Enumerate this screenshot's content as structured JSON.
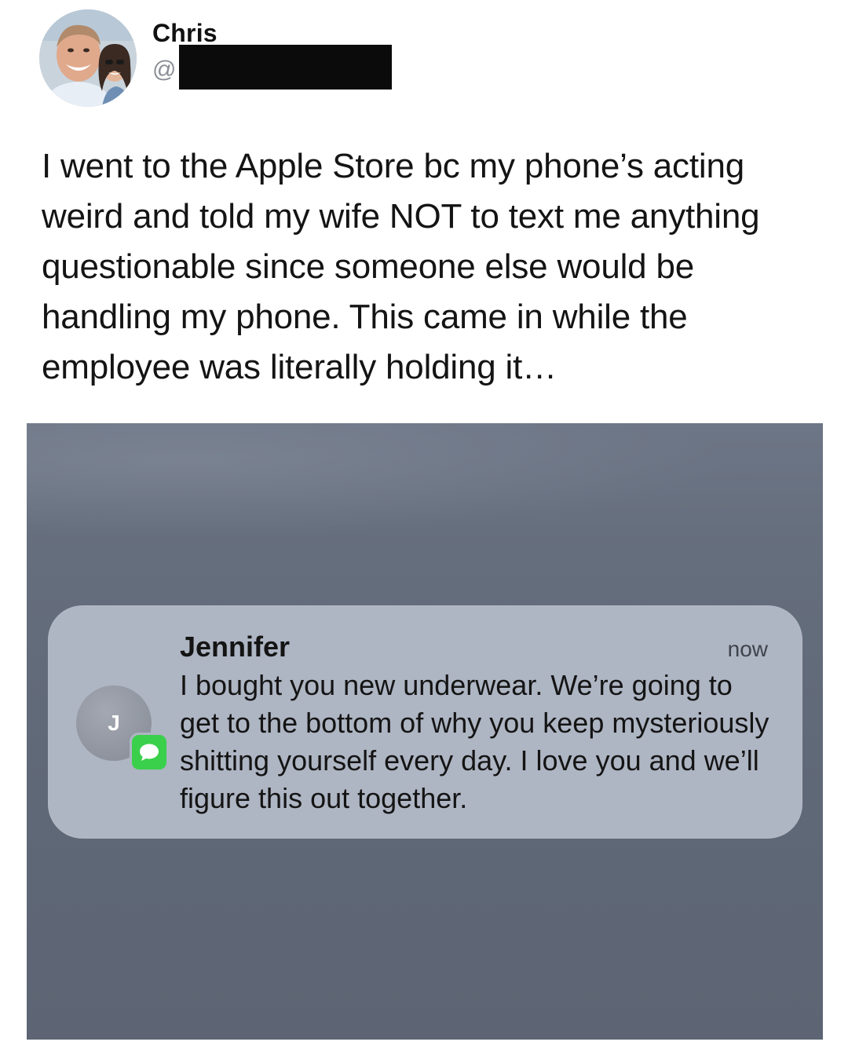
{
  "tweet": {
    "display_name": "Chris",
    "handle_prefix": "@",
    "avatar_icon": "profile-photo",
    "text": "I went to the Apple Store bc my phone’s acting weird and told my wife NOT to text me anything questionable since someone else would be handling my phone. This came in while the employee was literally holding it…"
  },
  "notification": {
    "sender": "Jennifer",
    "sender_initial": "J",
    "time": "now",
    "app_icon": "messages-icon",
    "message": "I bought you new underwear. We’re going to get to the bottom of why you keep mysteriously shitting yourself every day. I love you and we’ll figure this out together."
  },
  "colors": {
    "photo_background": "#636c7b",
    "notification_card": "#aeb5c3",
    "messages_green": "#3ad04b",
    "redaction": "#0b0b0b"
  }
}
